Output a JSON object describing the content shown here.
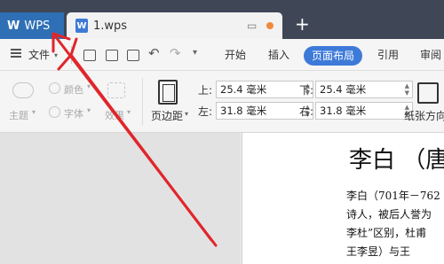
{
  "tabs": {
    "app_label": "WPS",
    "doc_label": "1.wps",
    "new_tab": "+"
  },
  "menu": {
    "file_label": "文件",
    "items": [
      "开始",
      "插入",
      "页面布局",
      "引用",
      "审阅"
    ],
    "active": "页面布局"
  },
  "ribbon": {
    "theme_label": "主题",
    "color_label": "颜色",
    "font_label": "字体",
    "effect_label": "效果",
    "margin_label": "页边距",
    "orientation_label": "纸张方向",
    "top_label": "上:",
    "top_value": "25.4 毫米",
    "bottom_label": "下:",
    "bottom_value": "25.4 毫米",
    "left_label": "左:",
    "left_value": "31.8 毫米",
    "right_label": "右:",
    "right_value": "31.8 毫米"
  },
  "document": {
    "title": "李白 （唐",
    "lines": [
      "李白（701年－762",
      "诗人，被后人誉为",
      "李杜”区别，杜甫",
      "王李昱）与王"
    ]
  },
  "annotation": {
    "color": "#e0262b"
  },
  "colors": {
    "titlebar": "#3f4757",
    "wps_tab": "#2f6fb5",
    "accent": "#3d7ad8"
  }
}
